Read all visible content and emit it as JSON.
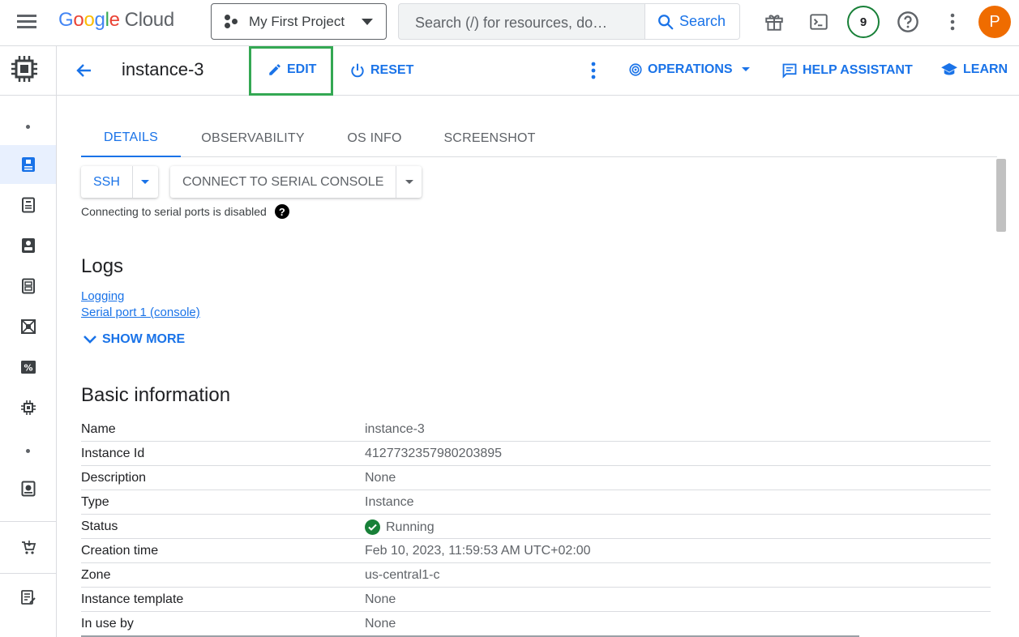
{
  "topbar": {
    "logo_letters": [
      "G",
      "o",
      "o",
      "g",
      "l",
      "e"
    ],
    "logo_suffix": "Cloud",
    "project": "My First Project",
    "search_placeholder": "Search (/) for resources, do…",
    "search_button": "Search",
    "notification_count": "9",
    "avatar_initial": "P"
  },
  "header": {
    "title": "instance-3",
    "edit": "EDIT",
    "reset": "RESET",
    "operations": "OPERATIONS",
    "help_assistant": "HELP ASSISTANT",
    "learn": "LEARN"
  },
  "tabs": [
    {
      "label": "DETAILS",
      "active": true
    },
    {
      "label": "OBSERVABILITY",
      "active": false
    },
    {
      "label": "OS INFO",
      "active": false
    },
    {
      "label": "SCREENSHOT",
      "active": false
    }
  ],
  "actions": {
    "ssh": "SSH",
    "serial_console": "CONNECT TO SERIAL CONSOLE",
    "serial_hint": "Connecting to serial ports is disabled",
    "help_glyph": "?"
  },
  "logs": {
    "heading": "Logs",
    "links": [
      "Logging",
      "Serial port 1 (console)"
    ],
    "show_more": "SHOW MORE"
  },
  "basic_info": {
    "heading": "Basic information",
    "rows": [
      {
        "key": "Name",
        "value": "instance-3"
      },
      {
        "key": "Instance Id",
        "value": "4127732357980203895"
      },
      {
        "key": "Description",
        "value": "None"
      },
      {
        "key": "Type",
        "value": "Instance"
      },
      {
        "key": "Status",
        "value": "Running"
      },
      {
        "key": "Creation time",
        "value": "Feb 10, 2023, 11:59:53 AM UTC+02:00"
      },
      {
        "key": "Zone",
        "value": "us-central1-c"
      },
      {
        "key": "Instance template",
        "value": "None"
      },
      {
        "key": "In use by",
        "value": "None"
      }
    ]
  },
  "colors": {
    "accent": "#1a73e8",
    "highlight": "#34a853",
    "status_ok": "#188038",
    "avatar": "#ef6c00"
  },
  "rail_icons": [
    "compute-engine-icon",
    "vm-instances-icon",
    "instance-templates-icon",
    "sole-tenant-icon",
    "machine-images-icon",
    "tpus-icon",
    "committed-use-icon",
    "migrate-icon",
    "storage-icon",
    "marketplace-icon",
    "release-notes-icon"
  ]
}
